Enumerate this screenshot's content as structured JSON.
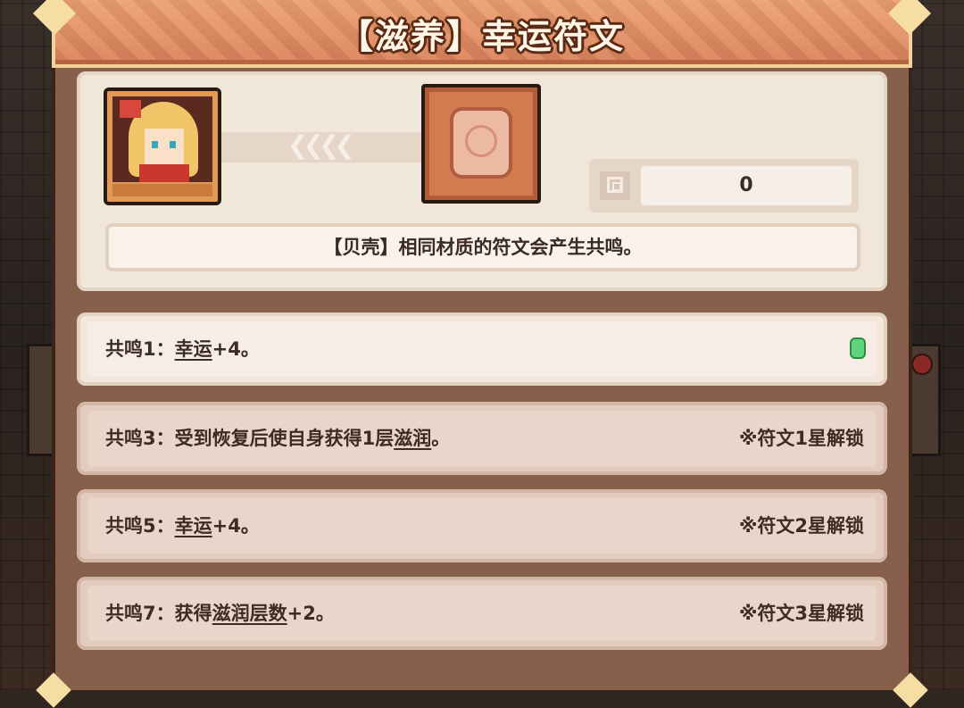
{
  "header": {
    "title": "【滋养】幸运符文"
  },
  "rune": {
    "count": "0"
  },
  "description": "【贝壳】相同材质的符文会产生共鸣。",
  "resonances": [
    {
      "prefix": "共鸣1：",
      "keyword": "幸运",
      "suffix": "+4。",
      "unlock": "",
      "active": true
    },
    {
      "prefix": "共鸣3：受到恢复后使自身获得1层",
      "keyword": "滋润",
      "suffix": "。",
      "unlock": "※符文1星解锁",
      "active": false
    },
    {
      "prefix": "共鸣5：",
      "keyword": "幸运",
      "suffix": "+4。",
      "unlock": "※符文2星解锁",
      "active": false
    },
    {
      "prefix": "共鸣7：获得",
      "keyword": "滋润层数",
      "suffix": "+2。",
      "unlock": "※符文3星解锁",
      "active": false
    }
  ],
  "colors": {
    "active_gem": "#5fd47b",
    "header": "#e8966a",
    "panel": "#86604a"
  }
}
